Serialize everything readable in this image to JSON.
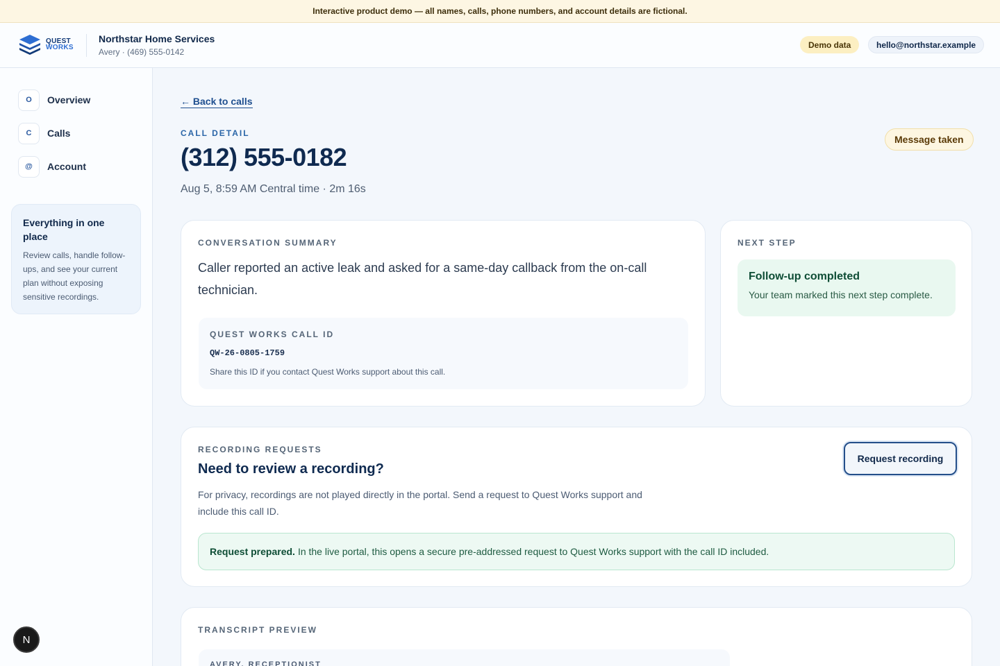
{
  "banner": {
    "text": "Interactive product demo — all names, calls, phone numbers, and account details are fictional."
  },
  "brand": {
    "logo_line1": "QUEST",
    "logo_line2": "WORKS",
    "colors": {
      "primary": "#123a78",
      "accent": "#2e6ed2"
    }
  },
  "account": {
    "company": "Northstar Home Services",
    "subline": "Avery · (469) 555-0142",
    "demo_badge": "Demo data",
    "email": "hello@northstar.example"
  },
  "sidebar": {
    "items": [
      {
        "icon": "O",
        "label": "Overview"
      },
      {
        "icon": "C",
        "label": "Calls"
      },
      {
        "icon": "@",
        "label": "Account"
      }
    ],
    "card": {
      "title": "Everything in one place",
      "text": "Review calls, handle follow-ups, and see your current plan without exposing sensitive recordings."
    },
    "avatar": "N"
  },
  "call": {
    "back_label": "← Back to calls",
    "eyebrow": "CALL DETAIL",
    "phone": "(312) 555-0182",
    "meta": "Aug 5, 8:59 AM Central time · 2m 16s",
    "status": "Message taken"
  },
  "summary": {
    "eyebrow": "CONVERSATION SUMMARY",
    "text": "Caller reported an active leak and asked for a same-day callback from the on-call technician.",
    "id_label": "QUEST WORKS CALL ID",
    "id_value": "QW-26-0805-1759",
    "id_note": "Share this ID if you contact Quest Works support about this call."
  },
  "next_step": {
    "eyebrow": "NEXT STEP",
    "title": "Follow-up completed",
    "text": "Your team marked this next step complete."
  },
  "recording": {
    "eyebrow": "RECORDING REQUESTS",
    "title": "Need to review a recording?",
    "text": "For privacy, recordings are not played directly in the portal. Send a request to Quest Works support and include this call ID.",
    "button": "Request recording",
    "prepared_bold": "Request prepared.",
    "prepared_text": "In the live portal, this opens a secure pre-addressed request to Quest Works support with the call ID included."
  },
  "transcript": {
    "eyebrow": "TRANSCRIPT PREVIEW",
    "speaker": "AVERY, RECEPTIONIST"
  }
}
